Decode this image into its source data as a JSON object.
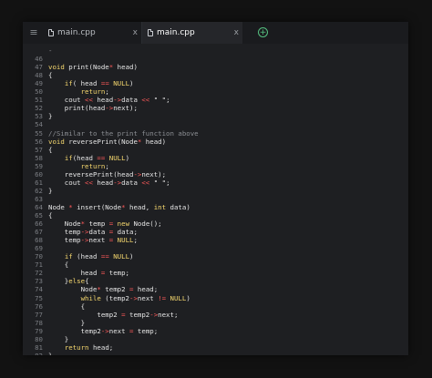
{
  "tabbar": {
    "menu_icon": "hamburger-menu-icon",
    "tabs": [
      {
        "label": "main.cpp",
        "close": "x",
        "active": false
      },
      {
        "label": "main.cpp",
        "close": "x",
        "active": true
      }
    ],
    "add_icon": "plus-circle-icon",
    "add_symbol": "+"
  },
  "colors": {
    "keyword": "#f5d76e",
    "operator": "#ff5a5a",
    "comment": "#8b8e93",
    "text": "#e6e6e6",
    "line_number": "#7b7e83",
    "add_button": "#55c080"
  },
  "editor": {
    "lines": [
      {
        "n": "",
        "segments": [
          {
            "t": "-",
            "c": "cm"
          }
        ]
      },
      {
        "n": "46",
        "segments": []
      },
      {
        "n": "47",
        "segments": [
          {
            "t": "void",
            "c": "kw"
          },
          {
            "t": " print(Node",
            "c": ""
          },
          {
            "t": "*",
            "c": "op"
          },
          {
            "t": " head)",
            "c": ""
          }
        ]
      },
      {
        "n": "48",
        "segments": [
          {
            "t": "{",
            "c": ""
          }
        ]
      },
      {
        "n": "49",
        "segments": [
          {
            "t": "    ",
            "c": ""
          },
          {
            "t": "if",
            "c": "kw"
          },
          {
            "t": "( head ",
            "c": ""
          },
          {
            "t": "==",
            "c": "op"
          },
          {
            "t": " ",
            "c": ""
          },
          {
            "t": "NULL",
            "c": "kw"
          },
          {
            "t": ")",
            "c": ""
          }
        ]
      },
      {
        "n": "50",
        "segments": [
          {
            "t": "        ",
            "c": ""
          },
          {
            "t": "return",
            "c": "kw"
          },
          {
            "t": ";",
            "c": ""
          }
        ]
      },
      {
        "n": "51",
        "segments": [
          {
            "t": "    cout ",
            "c": ""
          },
          {
            "t": "<<",
            "c": "op"
          },
          {
            "t": " head",
            "c": ""
          },
          {
            "t": "->",
            "c": "op"
          },
          {
            "t": "data ",
            "c": ""
          },
          {
            "t": "<<",
            "c": "op"
          },
          {
            "t": " \" \";",
            "c": ""
          }
        ]
      },
      {
        "n": "52",
        "segments": [
          {
            "t": "    print(head",
            "c": ""
          },
          {
            "t": "->",
            "c": "op"
          },
          {
            "t": "next);",
            "c": ""
          }
        ]
      },
      {
        "n": "53",
        "segments": [
          {
            "t": "}",
            "c": ""
          }
        ]
      },
      {
        "n": "54",
        "segments": []
      },
      {
        "n": "55",
        "segments": [
          {
            "t": "//Similar to the print function above",
            "c": "cm"
          }
        ]
      },
      {
        "n": "56",
        "segments": [
          {
            "t": "void",
            "c": "kw"
          },
          {
            "t": " reversePrint(Node",
            "c": ""
          },
          {
            "t": "*",
            "c": "op"
          },
          {
            "t": " head)",
            "c": ""
          }
        ]
      },
      {
        "n": "57",
        "segments": [
          {
            "t": "{",
            "c": ""
          }
        ]
      },
      {
        "n": "58",
        "segments": [
          {
            "t": "    ",
            "c": ""
          },
          {
            "t": "if",
            "c": "kw"
          },
          {
            "t": "(head ",
            "c": ""
          },
          {
            "t": "==",
            "c": "op"
          },
          {
            "t": " ",
            "c": ""
          },
          {
            "t": "NULL",
            "c": "kw"
          },
          {
            "t": ")",
            "c": ""
          }
        ]
      },
      {
        "n": "59",
        "segments": [
          {
            "t": "        ",
            "c": ""
          },
          {
            "t": "return",
            "c": "kw"
          },
          {
            "t": ";",
            "c": ""
          }
        ]
      },
      {
        "n": "60",
        "segments": [
          {
            "t": "    reversePrint(head",
            "c": ""
          },
          {
            "t": "->",
            "c": "op"
          },
          {
            "t": "next);",
            "c": ""
          }
        ]
      },
      {
        "n": "61",
        "segments": [
          {
            "t": "    cout ",
            "c": ""
          },
          {
            "t": "<<",
            "c": "op"
          },
          {
            "t": " head",
            "c": ""
          },
          {
            "t": "->",
            "c": "op"
          },
          {
            "t": "data ",
            "c": ""
          },
          {
            "t": "<<",
            "c": "op"
          },
          {
            "t": " \" \";",
            "c": ""
          }
        ]
      },
      {
        "n": "62",
        "segments": [
          {
            "t": "}",
            "c": ""
          }
        ]
      },
      {
        "n": "63",
        "segments": []
      },
      {
        "n": "64",
        "segments": [
          {
            "t": "Node ",
            "c": ""
          },
          {
            "t": "*",
            "c": "op"
          },
          {
            "t": " insert(Node",
            "c": ""
          },
          {
            "t": "*",
            "c": "op"
          },
          {
            "t": " head, ",
            "c": ""
          },
          {
            "t": "int",
            "c": "kw"
          },
          {
            "t": " data)",
            "c": ""
          }
        ]
      },
      {
        "n": "65",
        "segments": [
          {
            "t": "{",
            "c": ""
          }
        ]
      },
      {
        "n": "66",
        "segments": [
          {
            "t": "    Node",
            "c": ""
          },
          {
            "t": "*",
            "c": "op"
          },
          {
            "t": " temp ",
            "c": ""
          },
          {
            "t": "=",
            "c": "op"
          },
          {
            "t": " ",
            "c": ""
          },
          {
            "t": "new",
            "c": "kw"
          },
          {
            "t": " Node();",
            "c": ""
          }
        ]
      },
      {
        "n": "67",
        "segments": [
          {
            "t": "    temp",
            "c": ""
          },
          {
            "t": "->",
            "c": "op"
          },
          {
            "t": "data ",
            "c": ""
          },
          {
            "t": "=",
            "c": "op"
          },
          {
            "t": " data;",
            "c": ""
          }
        ]
      },
      {
        "n": "68",
        "segments": [
          {
            "t": "    temp",
            "c": ""
          },
          {
            "t": "->",
            "c": "op"
          },
          {
            "t": "next ",
            "c": ""
          },
          {
            "t": "=",
            "c": "op"
          },
          {
            "t": " ",
            "c": ""
          },
          {
            "t": "NULL",
            "c": "kw"
          },
          {
            "t": ";",
            "c": ""
          }
        ]
      },
      {
        "n": "69",
        "segments": []
      },
      {
        "n": "70",
        "segments": [
          {
            "t": "    ",
            "c": ""
          },
          {
            "t": "if",
            "c": "kw"
          },
          {
            "t": " (head ",
            "c": ""
          },
          {
            "t": "==",
            "c": "op"
          },
          {
            "t": " ",
            "c": ""
          },
          {
            "t": "NULL",
            "c": "kw"
          },
          {
            "t": ")",
            "c": ""
          }
        ]
      },
      {
        "n": "71",
        "segments": [
          {
            "t": "    {",
            "c": ""
          }
        ]
      },
      {
        "n": "72",
        "segments": [
          {
            "t": "        head ",
            "c": ""
          },
          {
            "t": "=",
            "c": "op"
          },
          {
            "t": " temp;",
            "c": ""
          }
        ]
      },
      {
        "n": "73",
        "segments": [
          {
            "t": "    }",
            "c": ""
          },
          {
            "t": "else",
            "c": "kw"
          },
          {
            "t": "{",
            "c": ""
          }
        ]
      },
      {
        "n": "74",
        "segments": [
          {
            "t": "        Node",
            "c": ""
          },
          {
            "t": "*",
            "c": "op"
          },
          {
            "t": " temp2 ",
            "c": ""
          },
          {
            "t": "=",
            "c": "op"
          },
          {
            "t": " head;",
            "c": ""
          }
        ]
      },
      {
        "n": "75",
        "segments": [
          {
            "t": "        ",
            "c": ""
          },
          {
            "t": "while",
            "c": "kw"
          },
          {
            "t": " (temp2",
            "c": ""
          },
          {
            "t": "->",
            "c": "op"
          },
          {
            "t": "next ",
            "c": ""
          },
          {
            "t": "!=",
            "c": "op"
          },
          {
            "t": " ",
            "c": ""
          },
          {
            "t": "NULL",
            "c": "kw"
          },
          {
            "t": ")",
            "c": ""
          }
        ]
      },
      {
        "n": "76",
        "segments": [
          {
            "t": "        {",
            "c": ""
          }
        ]
      },
      {
        "n": "77",
        "segments": [
          {
            "t": "            temp2 ",
            "c": ""
          },
          {
            "t": "=",
            "c": "op"
          },
          {
            "t": " temp2",
            "c": ""
          },
          {
            "t": "->",
            "c": "op"
          },
          {
            "t": "next;",
            "c": ""
          }
        ]
      },
      {
        "n": "78",
        "segments": [
          {
            "t": "        }",
            "c": ""
          }
        ]
      },
      {
        "n": "79",
        "segments": [
          {
            "t": "        temp2",
            "c": ""
          },
          {
            "t": "->",
            "c": "op"
          },
          {
            "t": "next ",
            "c": ""
          },
          {
            "t": "=",
            "c": "op"
          },
          {
            "t": " temp;",
            "c": ""
          }
        ]
      },
      {
        "n": "80",
        "segments": [
          {
            "t": "    }",
            "c": ""
          }
        ]
      },
      {
        "n": "81",
        "segments": [
          {
            "t": "    ",
            "c": ""
          },
          {
            "t": "return",
            "c": "kw"
          },
          {
            "t": " head;",
            "c": ""
          }
        ]
      },
      {
        "n": "82",
        "segments": [
          {
            "t": "}",
            "c": ""
          }
        ]
      }
    ]
  }
}
